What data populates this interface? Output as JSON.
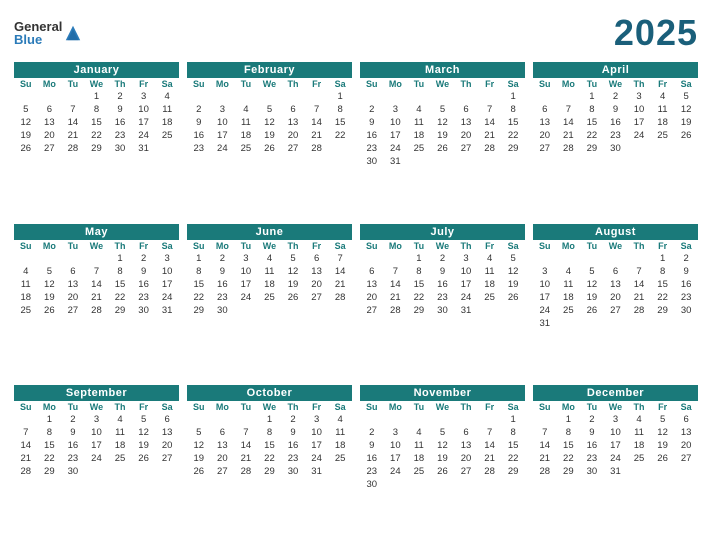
{
  "year": "2025",
  "logo": {
    "general": "General",
    "blue": "Blue"
  },
  "months": [
    {
      "name": "January",
      "days_header": [
        "Su",
        "Mo",
        "Tu",
        "We",
        "Th",
        "Fr",
        "Sa"
      ],
      "weeks": [
        [
          "",
          "",
          "",
          "1",
          "2",
          "3",
          "4"
        ],
        [
          "5",
          "6",
          "7",
          "8",
          "9",
          "10",
          "11"
        ],
        [
          "12",
          "13",
          "14",
          "15",
          "16",
          "17",
          "18"
        ],
        [
          "19",
          "20",
          "21",
          "22",
          "23",
          "24",
          "25"
        ],
        [
          "26",
          "27",
          "28",
          "29",
          "30",
          "31",
          ""
        ]
      ]
    },
    {
      "name": "February",
      "days_header": [
        "Su",
        "Mo",
        "Tu",
        "We",
        "Th",
        "Fr",
        "Sa"
      ],
      "weeks": [
        [
          "",
          "",
          "",
          "",
          "",
          "",
          "1"
        ],
        [
          "2",
          "3",
          "4",
          "5",
          "6",
          "7",
          "8"
        ],
        [
          "9",
          "10",
          "11",
          "12",
          "13",
          "14",
          "15"
        ],
        [
          "16",
          "17",
          "18",
          "19",
          "20",
          "21",
          "22"
        ],
        [
          "23",
          "24",
          "25",
          "26",
          "27",
          "28",
          ""
        ]
      ]
    },
    {
      "name": "March",
      "days_header": [
        "Su",
        "Mo",
        "Tu",
        "We",
        "Th",
        "Fr",
        "Sa"
      ],
      "weeks": [
        [
          "",
          "",
          "",
          "",
          "",
          "",
          "1"
        ],
        [
          "2",
          "3",
          "4",
          "5",
          "6",
          "7",
          "8"
        ],
        [
          "9",
          "10",
          "11",
          "12",
          "13",
          "14",
          "15"
        ],
        [
          "16",
          "17",
          "18",
          "19",
          "20",
          "21",
          "22"
        ],
        [
          "23",
          "24",
          "25",
          "26",
          "27",
          "28",
          "29"
        ],
        [
          "30",
          "31",
          "",
          "",
          "",
          "",
          ""
        ]
      ]
    },
    {
      "name": "April",
      "days_header": [
        "Su",
        "Mo",
        "Tu",
        "We",
        "Th",
        "Fr",
        "Sa"
      ],
      "weeks": [
        [
          "",
          "",
          "1",
          "2",
          "3",
          "4",
          "5"
        ],
        [
          "6",
          "7",
          "8",
          "9",
          "10",
          "11",
          "12"
        ],
        [
          "13",
          "14",
          "15",
          "16",
          "17",
          "18",
          "19"
        ],
        [
          "20",
          "21",
          "22",
          "23",
          "24",
          "25",
          "26"
        ],
        [
          "27",
          "28",
          "29",
          "30",
          "",
          "",
          ""
        ]
      ]
    },
    {
      "name": "May",
      "days_header": [
        "Su",
        "Mo",
        "Tu",
        "We",
        "Th",
        "Fr",
        "Sa"
      ],
      "weeks": [
        [
          "",
          "",
          "",
          "",
          "1",
          "2",
          "3"
        ],
        [
          "4",
          "5",
          "6",
          "7",
          "8",
          "9",
          "10"
        ],
        [
          "11",
          "12",
          "13",
          "14",
          "15",
          "16",
          "17"
        ],
        [
          "18",
          "19",
          "20",
          "21",
          "22",
          "23",
          "24"
        ],
        [
          "25",
          "26",
          "27",
          "28",
          "29",
          "30",
          "31"
        ]
      ]
    },
    {
      "name": "June",
      "days_header": [
        "Su",
        "Mo",
        "Tu",
        "We",
        "Th",
        "Fr",
        "Sa"
      ],
      "weeks": [
        [
          "1",
          "2",
          "3",
          "4",
          "5",
          "6",
          "7"
        ],
        [
          "8",
          "9",
          "10",
          "11",
          "12",
          "13",
          "14"
        ],
        [
          "15",
          "16",
          "17",
          "18",
          "19",
          "20",
          "21"
        ],
        [
          "22",
          "23",
          "24",
          "25",
          "26",
          "27",
          "28"
        ],
        [
          "29",
          "30",
          "",
          "",
          "",
          "",
          ""
        ]
      ]
    },
    {
      "name": "July",
      "days_header": [
        "Su",
        "Mo",
        "Tu",
        "We",
        "Th",
        "Fr",
        "Sa"
      ],
      "weeks": [
        [
          "",
          "",
          "1",
          "2",
          "3",
          "4",
          "5"
        ],
        [
          "6",
          "7",
          "8",
          "9",
          "10",
          "11",
          "12"
        ],
        [
          "13",
          "14",
          "15",
          "16",
          "17",
          "18",
          "19"
        ],
        [
          "20",
          "21",
          "22",
          "23",
          "24",
          "25",
          "26"
        ],
        [
          "27",
          "28",
          "29",
          "30",
          "31",
          "",
          ""
        ]
      ]
    },
    {
      "name": "August",
      "days_header": [
        "Su",
        "Mo",
        "Tu",
        "We",
        "Th",
        "Fr",
        "Sa"
      ],
      "weeks": [
        [
          "",
          "",
          "",
          "",
          "",
          "1",
          "2"
        ],
        [
          "3",
          "4",
          "5",
          "6",
          "7",
          "8",
          "9"
        ],
        [
          "10",
          "11",
          "12",
          "13",
          "14",
          "15",
          "16"
        ],
        [
          "17",
          "18",
          "19",
          "20",
          "21",
          "22",
          "23"
        ],
        [
          "24",
          "25",
          "26",
          "27",
          "28",
          "29",
          "30"
        ],
        [
          "31",
          "",
          "",
          "",
          "",
          "",
          ""
        ]
      ]
    },
    {
      "name": "September",
      "days_header": [
        "Su",
        "Mo",
        "Tu",
        "We",
        "Th",
        "Fr",
        "Sa"
      ],
      "weeks": [
        [
          "",
          "1",
          "2",
          "3",
          "4",
          "5",
          "6"
        ],
        [
          "7",
          "8",
          "9",
          "10",
          "11",
          "12",
          "13"
        ],
        [
          "14",
          "15",
          "16",
          "17",
          "18",
          "19",
          "20"
        ],
        [
          "21",
          "22",
          "23",
          "24",
          "25",
          "26",
          "27"
        ],
        [
          "28",
          "29",
          "30",
          "",
          "",
          "",
          ""
        ]
      ]
    },
    {
      "name": "October",
      "days_header": [
        "Su",
        "Mo",
        "Tu",
        "We",
        "Th",
        "Fr",
        "Sa"
      ],
      "weeks": [
        [
          "",
          "",
          "",
          "1",
          "2",
          "3",
          "4"
        ],
        [
          "5",
          "6",
          "7",
          "8",
          "9",
          "10",
          "11"
        ],
        [
          "12",
          "13",
          "14",
          "15",
          "16",
          "17",
          "18"
        ],
        [
          "19",
          "20",
          "21",
          "22",
          "23",
          "24",
          "25"
        ],
        [
          "26",
          "27",
          "28",
          "29",
          "30",
          "31",
          ""
        ]
      ]
    },
    {
      "name": "November",
      "days_header": [
        "Su",
        "Mo",
        "Tu",
        "We",
        "Th",
        "Fr",
        "Sa"
      ],
      "weeks": [
        [
          "",
          "",
          "",
          "",
          "",
          "",
          "1"
        ],
        [
          "2",
          "3",
          "4",
          "5",
          "6",
          "7",
          "8"
        ],
        [
          "9",
          "10",
          "11",
          "12",
          "13",
          "14",
          "15"
        ],
        [
          "16",
          "17",
          "18",
          "19",
          "20",
          "21",
          "22"
        ],
        [
          "23",
          "24",
          "25",
          "26",
          "27",
          "28",
          "29"
        ],
        [
          "30",
          "",
          "",
          "",
          "",
          "",
          ""
        ]
      ]
    },
    {
      "name": "December",
      "days_header": [
        "Su",
        "Mo",
        "Tu",
        "We",
        "Th",
        "Fr",
        "Sa"
      ],
      "weeks": [
        [
          "",
          "1",
          "2",
          "3",
          "4",
          "5",
          "6"
        ],
        [
          "7",
          "8",
          "9",
          "10",
          "11",
          "12",
          "13"
        ],
        [
          "14",
          "15",
          "16",
          "17",
          "18",
          "19",
          "20"
        ],
        [
          "21",
          "22",
          "23",
          "24",
          "25",
          "26",
          "27"
        ],
        [
          "28",
          "29",
          "30",
          "31",
          "",
          "",
          ""
        ]
      ]
    }
  ]
}
